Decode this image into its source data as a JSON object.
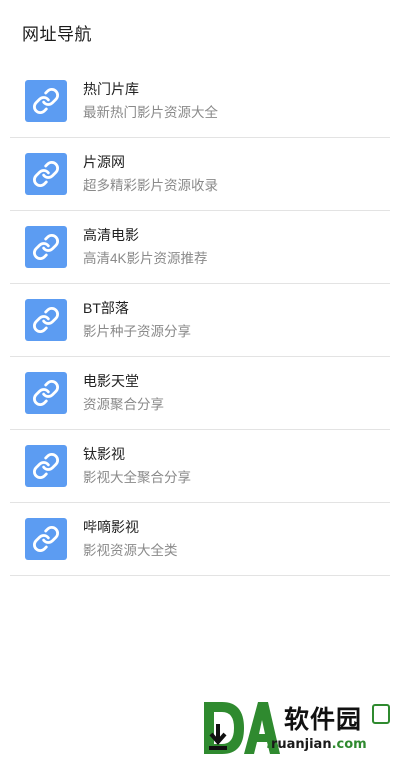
{
  "page": {
    "title": "网址导航"
  },
  "items": [
    {
      "title": "热门片库",
      "desc": "最新热门影片资源大全",
      "icon": "link-icon"
    },
    {
      "title": "片源网",
      "desc": "超多精彩影片资源收录",
      "icon": "link-icon"
    },
    {
      "title": "高清电影",
      "desc": "高清4K影片资源推荐",
      "icon": "link-icon"
    },
    {
      "title": "BT部落",
      "desc": "影片种子资源分享",
      "icon": "link-icon"
    },
    {
      "title": "电影天堂",
      "desc": "资源聚合分享",
      "icon": "link-icon"
    },
    {
      "title": "钛影视",
      "desc": "影视大全聚合分享",
      "icon": "link-icon"
    },
    {
      "title": "哔嘀影视",
      "desc": "影视资源大全类",
      "icon": "link-icon"
    }
  ],
  "watermark": {
    "name_cn": "软件园",
    "domain_prefix": ".",
    "domain_main": "ruanjian",
    "domain_suffix": ".com"
  },
  "colors": {
    "icon_tile": "#5c9cf2",
    "divider": "#e3e3e3",
    "desc_text": "#8a8a8a",
    "watermark_green": "#2f8a2f"
  }
}
